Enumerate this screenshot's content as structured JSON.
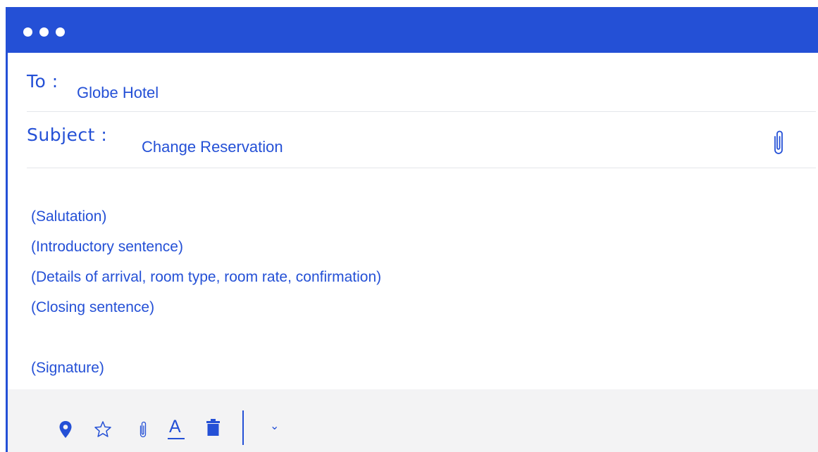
{
  "window": {
    "title_bar_color": "#2450d6",
    "window_controls": [
      "dot",
      "dot",
      "dot"
    ]
  },
  "to": {
    "label": "To :",
    "value": "Globe Hotel"
  },
  "subject": {
    "label": "Subject :",
    "value": "Change Reservation",
    "attachment_icon": "paperclip-icon"
  },
  "body": {
    "lines": [
      "(Salutation)",
      "(Introductory sentence)",
      "(Details of arrival, room type, room rate, confirmation)",
      "(Closing sentence)",
      "",
      "(Signature)"
    ]
  },
  "toolbar": {
    "icons": [
      "location-pin-icon",
      "star-icon",
      "paperclip-icon",
      "text-color-icon",
      "trash-icon",
      "chevron-down-icon"
    ],
    "text_format_glyph": "A",
    "chevron_glyph": "⌄"
  },
  "colors": {
    "accent": "#2450d6",
    "toolbar_bg": "#f3f3f4",
    "divider": "#e4e6ea"
  }
}
